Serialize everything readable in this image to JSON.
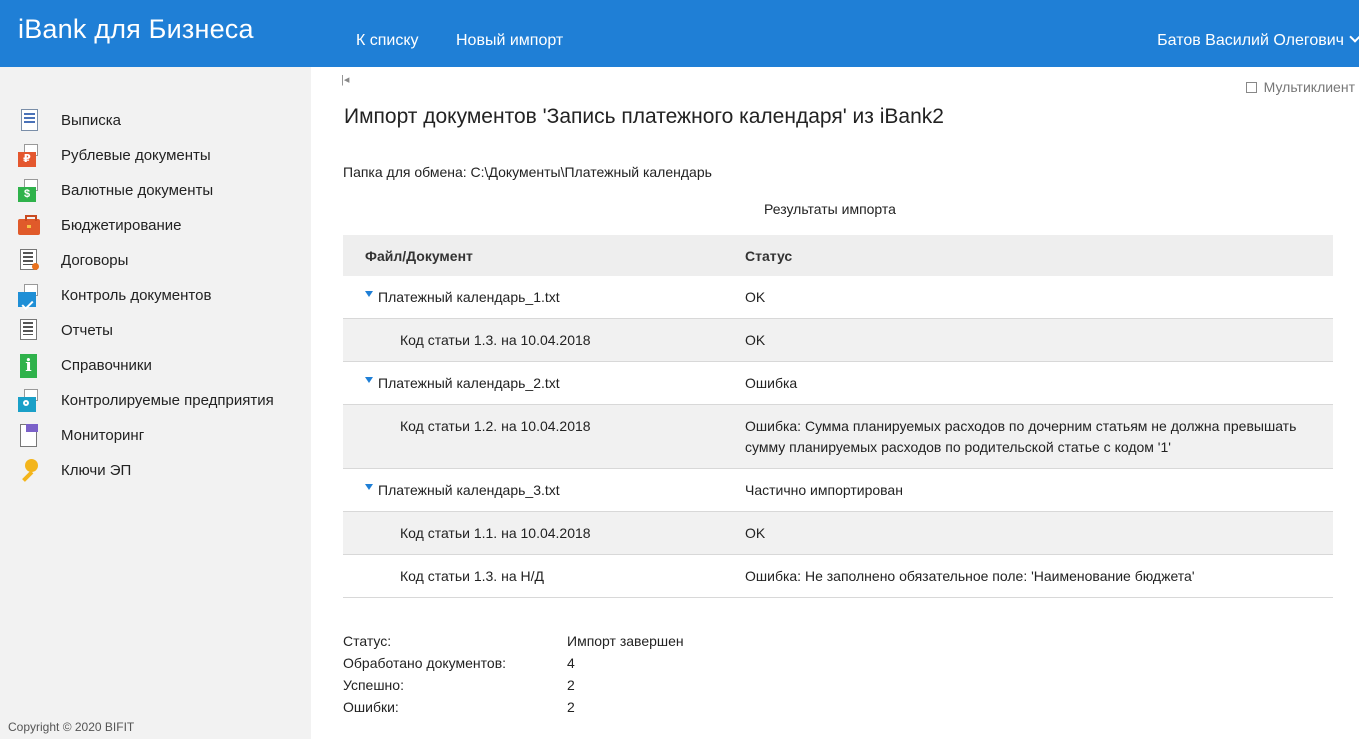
{
  "header": {
    "brand": "iBank для Бизнеса",
    "nav": [
      "К списку",
      "Новый импорт"
    ],
    "user": "Батов Василий Олегович"
  },
  "sidebar": {
    "items": [
      {
        "label": "Выписка",
        "icon": "statement-icon"
      },
      {
        "label": "Рублевые документы",
        "icon": "ruble-documents-icon"
      },
      {
        "label": "Валютные документы",
        "icon": "currency-documents-icon"
      },
      {
        "label": "Бюджетирование",
        "icon": "briefcase-icon"
      },
      {
        "label": "Договоры",
        "icon": "contract-icon"
      },
      {
        "label": "Контроль документов",
        "icon": "check-documents-icon"
      },
      {
        "label": "Отчеты",
        "icon": "reports-icon"
      },
      {
        "label": "Справочники",
        "icon": "info-icon"
      },
      {
        "label": "Контролируемые предприятия",
        "icon": "search-companies-icon"
      },
      {
        "label": "Мониторинг",
        "icon": "monitoring-icon"
      },
      {
        "label": "Ключи ЭП",
        "icon": "key-icon"
      }
    ],
    "copyright": "Copyright © 2020 BIFIT"
  },
  "main": {
    "multiclient": "Мультиклиент",
    "title": "Импорт документов 'Запись платежного календаря' из iBank2",
    "folder": "Папка для обмена: C:\\Документы\\Платежный календарь",
    "results_title": "Результаты импорта",
    "table": {
      "headers": [
        "Файл/Документ",
        "Статус"
      ],
      "rows": [
        {
          "kind": "file",
          "name": "Платежный календарь_1.txt",
          "status": "OK"
        },
        {
          "kind": "sub",
          "name": "Код статьи 1.3. на 10.04.2018",
          "status": "OK"
        },
        {
          "kind": "file",
          "name": "Платежный календарь_2.txt",
          "status": "Ошибка"
        },
        {
          "kind": "sub",
          "name": "Код статьи 1.2. на 10.04.2018",
          "status": "Ошибка: Сумма планируемых расходов по дочерним статьям не должна превышать сумму планируемых расходов по родительской статье с кодом '1'"
        },
        {
          "kind": "file",
          "name": "Платежный календарь_3.txt",
          "status": "Частично импортирован"
        },
        {
          "kind": "sub",
          "name": "Код статьи 1.1. на 10.04.2018",
          "status": "OK"
        },
        {
          "kind": "sub",
          "name": "Код статьи 1.3. на Н/Д",
          "status": "Ошибка: Не заполнено обязательное поле: 'Наименование бюджета'"
        }
      ]
    },
    "summary": [
      {
        "key": "Статус:",
        "value": "Импорт завершен"
      },
      {
        "key": "Обработано документов:",
        "value": "4"
      },
      {
        "key": "Успешно:",
        "value": "2"
      },
      {
        "key": "Ошибки:",
        "value": "2"
      }
    ]
  }
}
